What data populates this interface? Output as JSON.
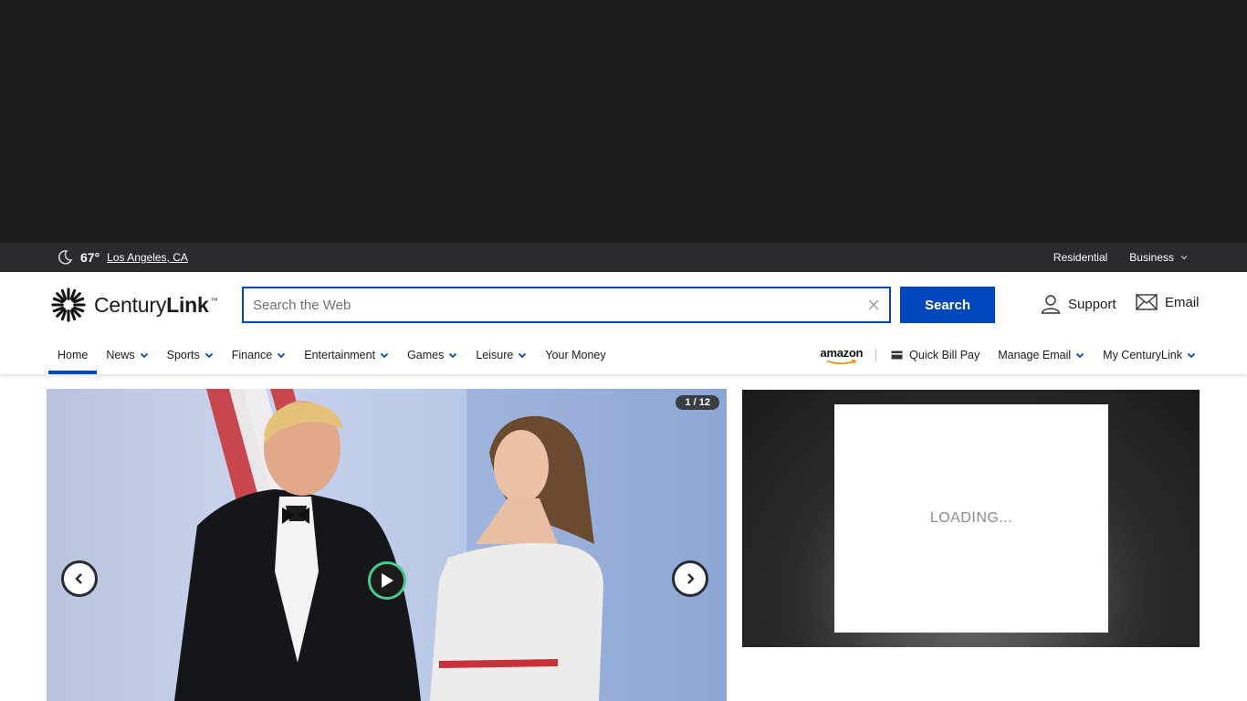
{
  "utility": {
    "temperature": "67°",
    "location": "Los Angeles, CA",
    "residential_label": "Residential",
    "business_label": "Business"
  },
  "brand": {
    "name_light": "Century",
    "name_bold": "Link",
    "tm": "™"
  },
  "search": {
    "placeholder": "Search the Web",
    "value": "",
    "button_label": "Search"
  },
  "header_links": {
    "support": "Support",
    "email": "Email"
  },
  "nav": {
    "items": [
      {
        "label": "Home",
        "active": true,
        "dropdown": false
      },
      {
        "label": "News",
        "dropdown": true
      },
      {
        "label": "Sports",
        "dropdown": true
      },
      {
        "label": "Finance",
        "dropdown": true
      },
      {
        "label": "Entertainment",
        "dropdown": true
      },
      {
        "label": "Games",
        "dropdown": true
      },
      {
        "label": "Leisure",
        "dropdown": true
      },
      {
        "label": "Your Money",
        "dropdown": false
      }
    ],
    "right": {
      "amazon": "amazon",
      "quick_bill_pay": "Quick Bill Pay",
      "manage_email": "Manage Email",
      "my_centurylink": "My CenturyLink"
    }
  },
  "hero": {
    "counter": "1 / 12"
  },
  "side_ad": {
    "loading_text": "LOADING..."
  },
  "colors": {
    "accent": "#0047bb",
    "utility_bar": "#2a2b30",
    "ad_background": "#1b1b1d",
    "play_ring": "#4bc98a"
  }
}
